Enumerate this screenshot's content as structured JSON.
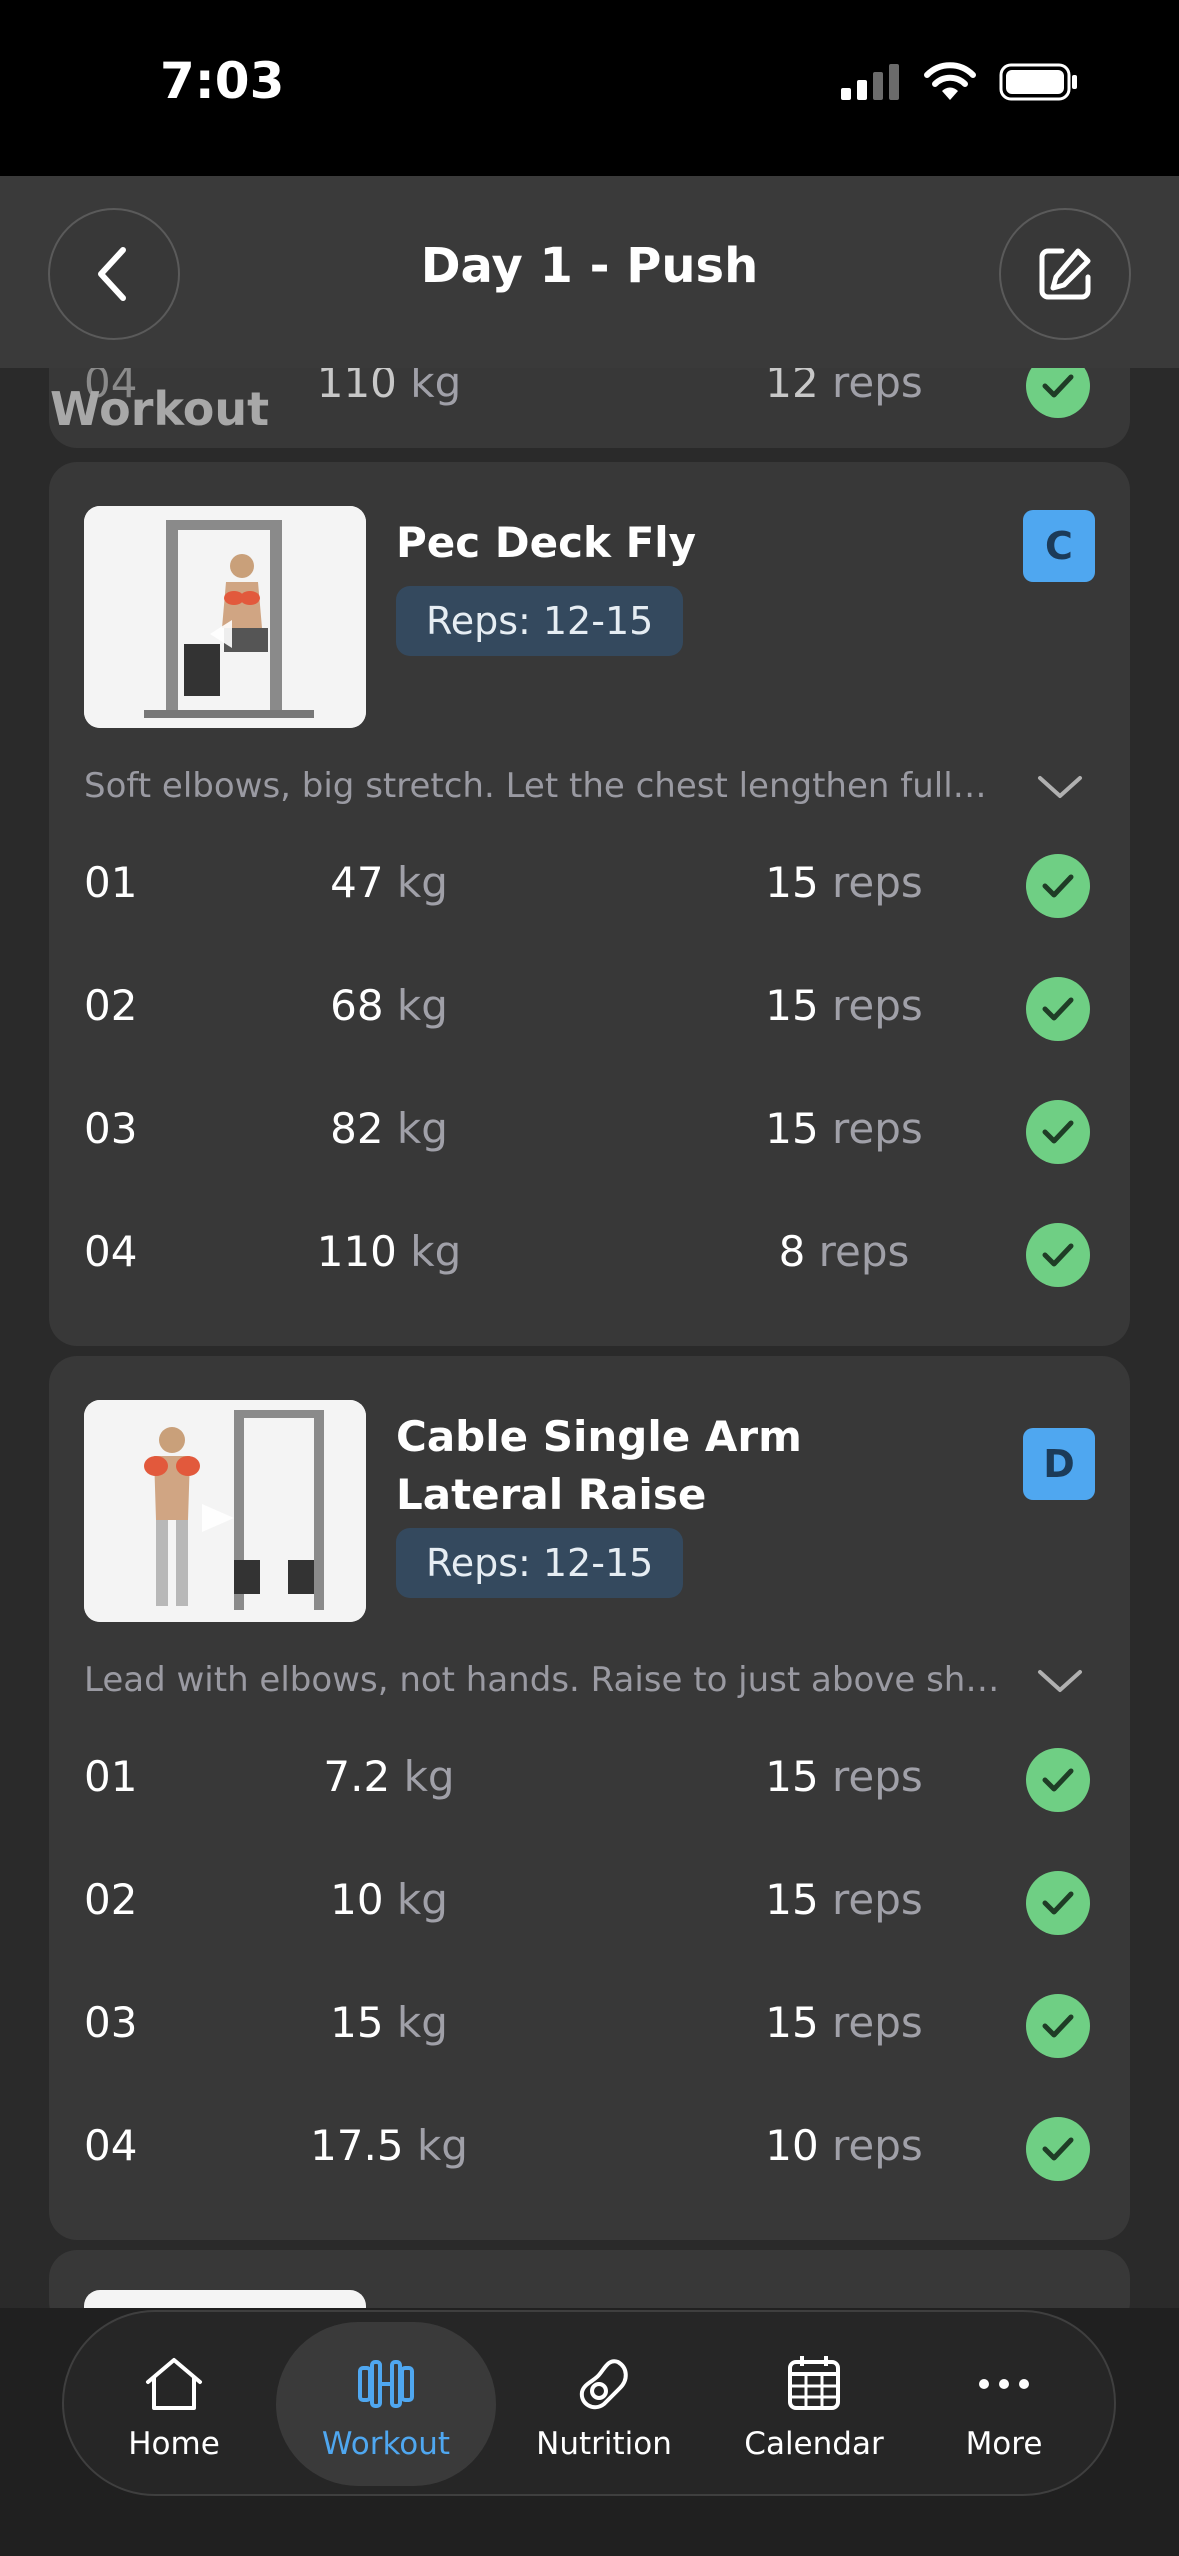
{
  "status": {
    "time": "7:03"
  },
  "header": {
    "title": "Day 1 - Push"
  },
  "section_label": "Workout",
  "prev_card": {
    "set": "04",
    "weight": "110",
    "weight_unit": "kg",
    "reps": "12",
    "reps_unit": "reps"
  },
  "exercises": [
    {
      "name": "Pec Deck Fly",
      "reps_target": "Reps: 12-15",
      "badge": "C",
      "note": "Soft elbows, big stretch. Let the chest lengthen fully before squeezing",
      "sets": [
        {
          "set": "01",
          "weight": "47",
          "weight_unit": "kg",
          "reps": "15",
          "reps_unit": "reps"
        },
        {
          "set": "02",
          "weight": "68",
          "weight_unit": "kg",
          "reps": "15",
          "reps_unit": "reps"
        },
        {
          "set": "03",
          "weight": "82",
          "weight_unit": "kg",
          "reps": "15",
          "reps_unit": "reps"
        },
        {
          "set": "04",
          "weight": "110",
          "weight_unit": "kg",
          "reps": "8",
          "reps_unit": "reps"
        }
      ]
    },
    {
      "name": "Cable Single Arm Lateral Raise",
      "reps_target": "Reps: 12-15",
      "badge": "D",
      "note": "Lead with elbows, not hands. Raise to just above shoulder height",
      "sets": [
        {
          "set": "01",
          "weight": "7.2",
          "weight_unit": "kg",
          "reps": "15",
          "reps_unit": "reps"
        },
        {
          "set": "02",
          "weight": "10",
          "weight_unit": "kg",
          "reps": "15",
          "reps_unit": "reps"
        },
        {
          "set": "03",
          "weight": "15",
          "weight_unit": "kg",
          "reps": "15",
          "reps_unit": "reps"
        },
        {
          "set": "04",
          "weight": "17.5",
          "weight_unit": "kg",
          "reps": "10",
          "reps_unit": "reps"
        }
      ]
    }
  ],
  "tabs": [
    {
      "label": "Home",
      "icon": "home-icon"
    },
    {
      "label": "Workout",
      "icon": "dumbbell-icon",
      "active": true
    },
    {
      "label": "Nutrition",
      "icon": "avocado-icon"
    },
    {
      "label": "Calendar",
      "icon": "calendar-icon"
    },
    {
      "label": "More",
      "icon": "more-icon"
    }
  ],
  "colors": {
    "accent": "#4fa7f0",
    "check": "#6fcf84",
    "card": "#383838",
    "background": "#2a2a2a"
  }
}
